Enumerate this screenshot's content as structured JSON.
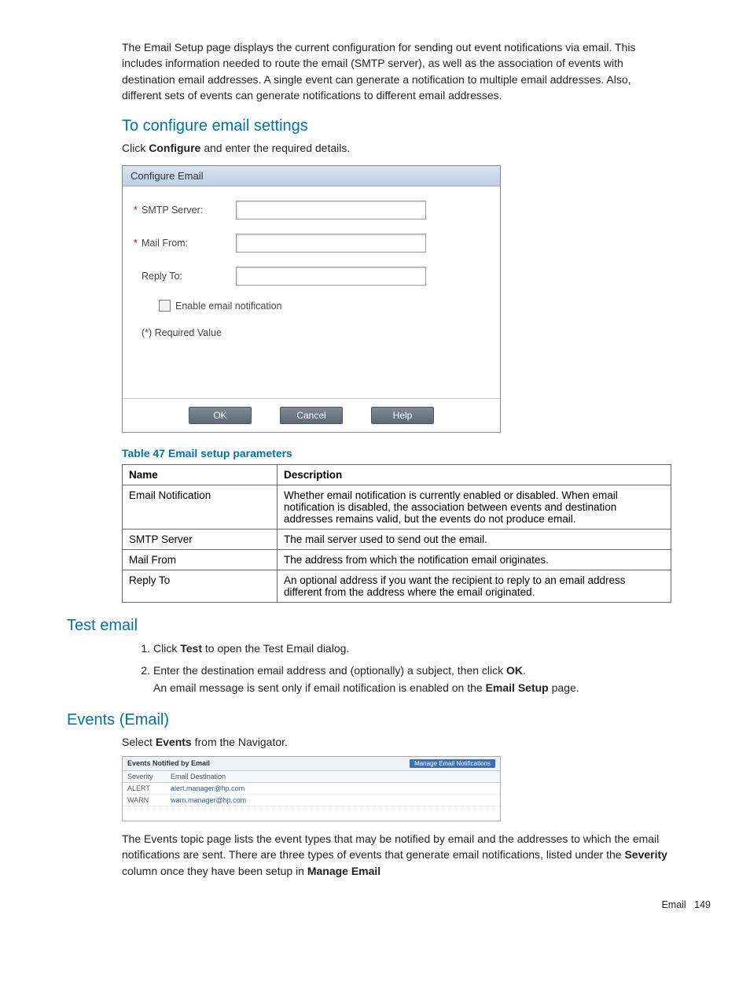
{
  "intro": "The Email Setup page displays the current configuration for sending out event notifications via email. This includes information needed to route the email (SMTP server), as well as the association of events with destination email addresses. A single event can generate a notification to multiple email addresses. Also, different sets of events can generate notifications to different email addresses.",
  "configure": {
    "heading": "To configure email settings",
    "instruction_pre": "Click ",
    "instruction_bold": "Configure",
    "instruction_post": " and enter the required details."
  },
  "dialog": {
    "title": "Configure Email",
    "smtp_label": "SMTP Server:",
    "mailfrom_label": "Mail From:",
    "replyto_label": "Reply To:",
    "enable_label": "Enable email notification",
    "required_note": "(*) Required Value",
    "ok": "OK",
    "cancel": "Cancel",
    "help": "Help"
  },
  "table": {
    "caption": "Table 47 Email setup parameters",
    "h1": "Name",
    "h2": "Description",
    "rows": [
      {
        "n": "Email Notification",
        "d": "Whether email notification is currently enabled or disabled. When email notification is disabled, the association between events and destination addresses remains valid, but the events do not produce email."
      },
      {
        "n": "SMTP Server",
        "d": "The mail server used to send out the email."
      },
      {
        "n": "Mail From",
        "d": "The address from which the notification email originates."
      },
      {
        "n": "Reply To",
        "d": "An optional address if you want the recipient to reply to an email address different from the address where the email originated."
      }
    ]
  },
  "test": {
    "heading": "Test email",
    "step1_a": "Click ",
    "step1_b": "Test",
    "step1_c": " to open the Test Email dialog.",
    "step2_a": "Enter the destination email address and (optionally) a subject, then click ",
    "step2_b": "OK",
    "step2_c": ".",
    "step2_note_a": "An email message is sent only if email notification is enabled on the ",
    "step2_note_b": "Email Setup",
    "step2_note_c": " page."
  },
  "events": {
    "heading": "Events (Email)",
    "intro_a": "Select ",
    "intro_b": "Events",
    "intro_c": " from the Navigator.",
    "panel": {
      "title": "Events Notified by Email",
      "button": "Manage Email Notifications",
      "col1": "Severity",
      "col2": "Email Destination",
      "rows": [
        {
          "s": "ALERT",
          "d": "alert.manager@hp.com"
        },
        {
          "s": "WARN",
          "d": "warn.manager@hp.com"
        }
      ]
    },
    "desc_a": "The Events topic page lists the event types that may be notified by email and the addresses to which the email notifications are sent. There are three types of events that generate email notifications, listed under the ",
    "desc_b": "Severity",
    "desc_c": " column once they have been setup in ",
    "desc_d": "Manage Email"
  },
  "footer": {
    "section": "Email",
    "page": "149"
  }
}
